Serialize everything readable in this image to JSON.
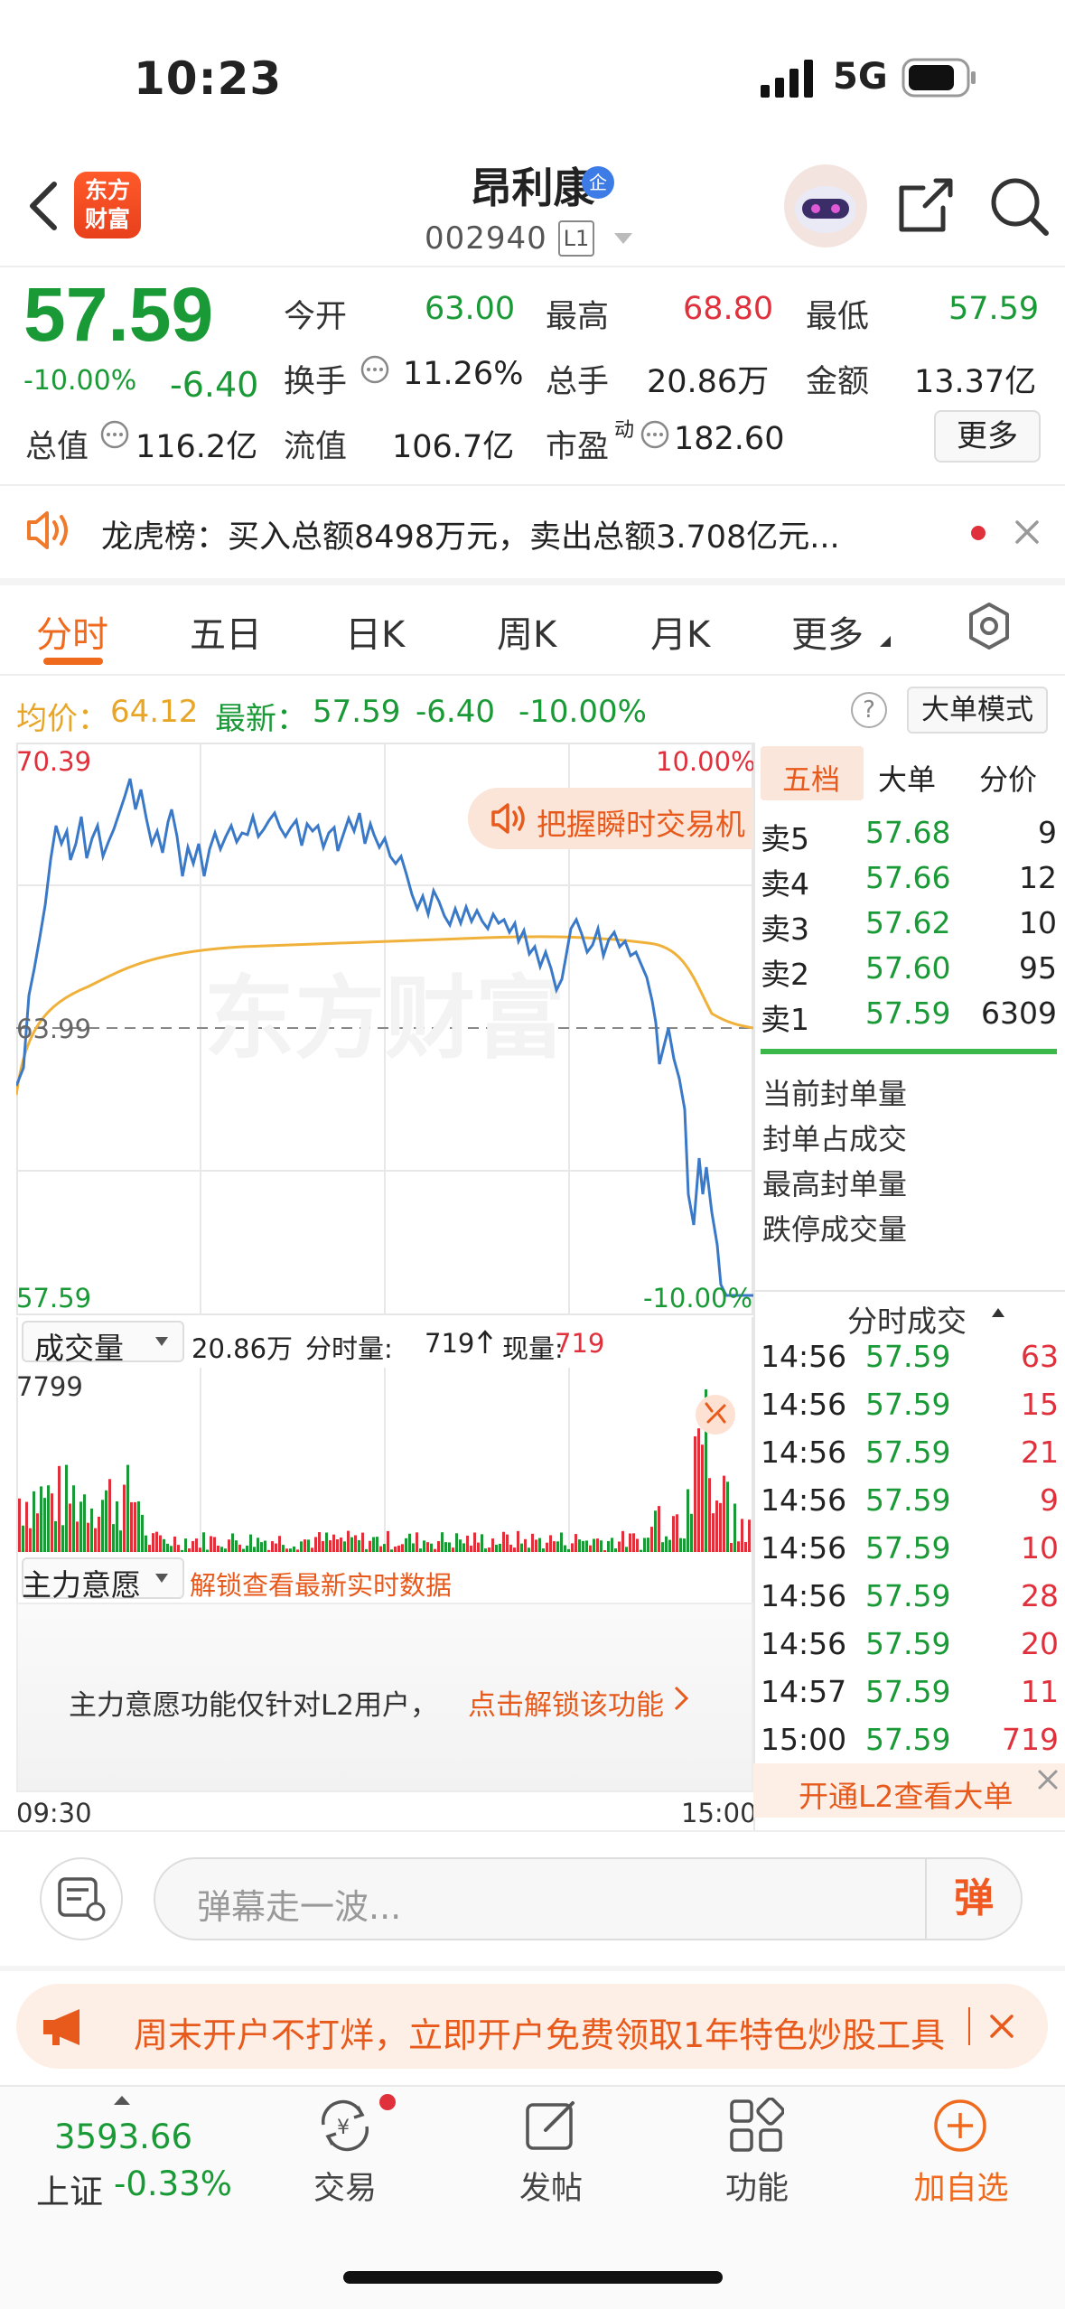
{
  "status_bar": {
    "time": "10:23",
    "network": "5G"
  },
  "header": {
    "logo_line1": "东方",
    "logo_line2": "财富",
    "stock_name": "昂利康",
    "badge": "企",
    "code": "002940",
    "level": "L1"
  },
  "quote": {
    "price": "57.59",
    "change_pct": "-10.00%",
    "change": "-6.40",
    "open_label": "今开",
    "open": "63.00",
    "high_label": "最高",
    "high": "68.80",
    "low_label": "最低",
    "low": "57.59",
    "turnover_label": "换手",
    "turnover": "11.26%",
    "volume_label": "总手",
    "volume": "20.86万",
    "amount_label": "金额",
    "amount": "13.37亿",
    "mktcap_label": "总值",
    "mktcap": "116.2亿",
    "float_label": "流值",
    "float": "106.7亿",
    "pe_label": "市盈",
    "pe_sup": "动",
    "pe": "182.60",
    "more": "更多"
  },
  "notice": {
    "text": "龙虎榜：买入总额8498万元，卖出总额3.708亿元..."
  },
  "tabs": [
    "分时",
    "五日",
    "日K",
    "周K",
    "月K",
    "更多"
  ],
  "info": {
    "avg_label": "均价：",
    "avg": "64.12",
    "latest_label": "最新：",
    "latest": "57.59",
    "latest_change": "-6.40",
    "latest_pct": "-10.00%",
    "help": "?",
    "mode_button": "大单模式"
  },
  "chart": {
    "y_high": "70.39",
    "y_mid": "63.99",
    "y_low": "57.59",
    "pct_high": "10.00%",
    "pct_low": "-10.00%",
    "watermark": "东方财富",
    "promo_pill": "把握瞬时交易机",
    "time_start": "09:30",
    "time_end": "15:00"
  },
  "volume_bar": {
    "selector": "成交量",
    "total": "20.86万",
    "tick_label": "分时量:",
    "tick": "719",
    "cur_label": "现量:",
    "cur": "719",
    "max": "7799"
  },
  "intent": {
    "selector": "主力意愿",
    "unlock_link": "解锁查看最新实时数据",
    "lock_msg": "主力意愿功能仅针对L2用户，",
    "lock_link": "点击解锁该功能"
  },
  "orderbook": {
    "tabs": [
      "五档",
      "大单",
      "分价"
    ],
    "rows": [
      {
        "label": "卖5",
        "price": "57.68",
        "qty": "9"
      },
      {
        "label": "卖4",
        "price": "57.66",
        "qty": "12"
      },
      {
        "label": "卖3",
        "price": "57.62",
        "qty": "10"
      },
      {
        "label": "卖2",
        "price": "57.60",
        "qty": "95"
      },
      {
        "label": "卖1",
        "price": "57.59",
        "qty": "6309"
      }
    ],
    "seal_items": [
      "当前封单量",
      "封单占成交",
      "最高封单量",
      "跌停成交量"
    ]
  },
  "trades": {
    "title": "分时成交",
    "rows": [
      {
        "time": "14:56",
        "price": "57.59",
        "qty": "63"
      },
      {
        "time": "14:56",
        "price": "57.59",
        "qty": "15"
      },
      {
        "time": "14:56",
        "price": "57.59",
        "qty": "21"
      },
      {
        "time": "14:56",
        "price": "57.59",
        "qty": "9"
      },
      {
        "time": "14:56",
        "price": "57.59",
        "qty": "10"
      },
      {
        "time": "14:56",
        "price": "57.59",
        "qty": "28"
      },
      {
        "time": "14:56",
        "price": "57.59",
        "qty": "20"
      },
      {
        "time": "14:57",
        "price": "57.59",
        "qty": "11"
      },
      {
        "time": "15:00",
        "price": "57.59",
        "qty": "719"
      }
    ],
    "l2_banner": "开通L2查看大单"
  },
  "comment": {
    "placeholder": "弹幕走一波...",
    "button": "弹"
  },
  "promo": {
    "text": "周末开户不打烊，立即开户免费领取1年特色炒股工具"
  },
  "bottom_nav": {
    "index_value": "3593.66",
    "index_name": "上证",
    "index_change": "-0.33%",
    "trade": "交易",
    "post": "发帖",
    "functions": "功能",
    "add_watch": "加自选"
  }
}
